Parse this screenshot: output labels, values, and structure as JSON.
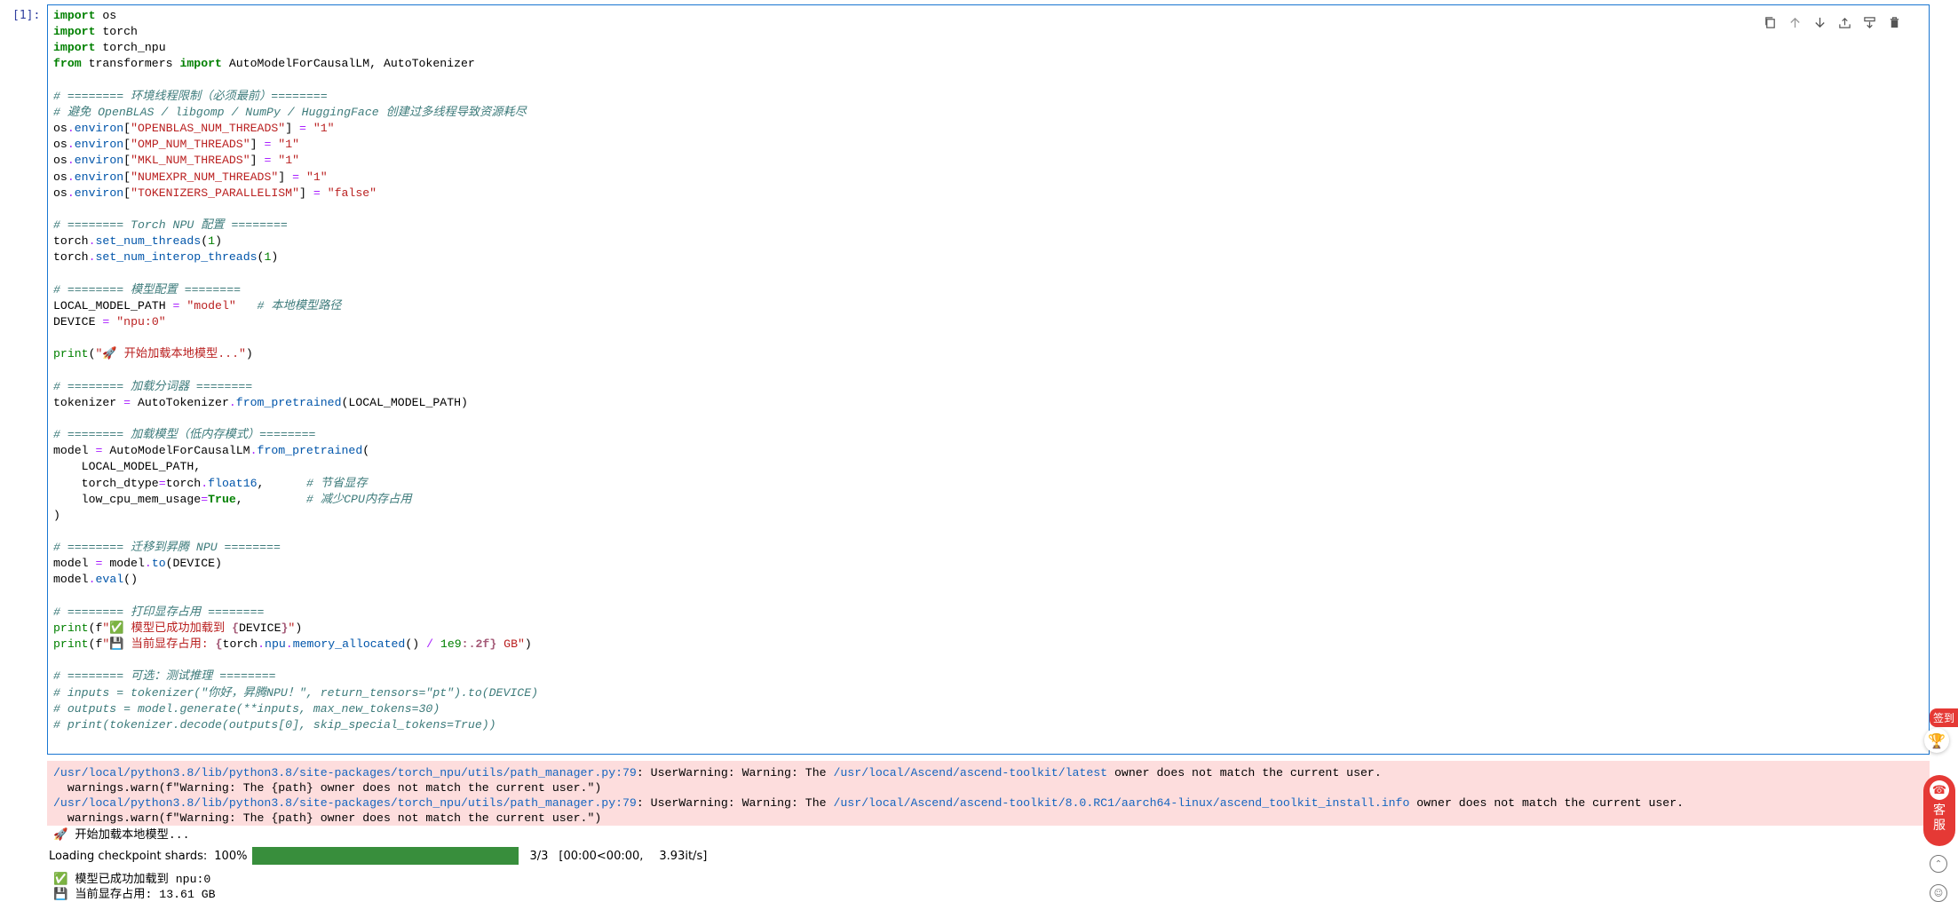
{
  "cell": {
    "prompt": "[1]:",
    "code_lines": [
      [
        {
          "t": "import",
          "c": "kw"
        },
        {
          "t": " os"
        }
      ],
      [
        {
          "t": "import",
          "c": "kw"
        },
        {
          "t": " torch"
        }
      ],
      [
        {
          "t": "import",
          "c": "kw"
        },
        {
          "t": " torch_npu"
        }
      ],
      [
        {
          "t": "from",
          "c": "kw"
        },
        {
          "t": " transformers "
        },
        {
          "t": "import",
          "c": "kw"
        },
        {
          "t": " AutoModelForCausalLM, AutoTokenizer"
        }
      ],
      [],
      [
        {
          "t": "# ======== 环境线程限制（必须最前）========",
          "c": "cm"
        }
      ],
      [
        {
          "t": "# 避免 OpenBLAS / libgomp / NumPy / HuggingFace 创建过多线程导致资源耗尽",
          "c": "cm"
        }
      ],
      [
        {
          "t": "os"
        },
        {
          "t": ".",
          "c": "op"
        },
        {
          "t": "environ",
          "c": "fn"
        },
        {
          "t": "["
        },
        {
          "t": "\"OPENBLAS_NUM_THREADS\"",
          "c": "str"
        },
        {
          "t": "] "
        },
        {
          "t": "=",
          "c": "op"
        },
        {
          "t": " "
        },
        {
          "t": "\"1\"",
          "c": "str"
        }
      ],
      [
        {
          "t": "os"
        },
        {
          "t": ".",
          "c": "op"
        },
        {
          "t": "environ",
          "c": "fn"
        },
        {
          "t": "["
        },
        {
          "t": "\"OMP_NUM_THREADS\"",
          "c": "str"
        },
        {
          "t": "] "
        },
        {
          "t": "=",
          "c": "op"
        },
        {
          "t": " "
        },
        {
          "t": "\"1\"",
          "c": "str"
        }
      ],
      [
        {
          "t": "os"
        },
        {
          "t": ".",
          "c": "op"
        },
        {
          "t": "environ",
          "c": "fn"
        },
        {
          "t": "["
        },
        {
          "t": "\"MKL_NUM_THREADS\"",
          "c": "str"
        },
        {
          "t": "] "
        },
        {
          "t": "=",
          "c": "op"
        },
        {
          "t": " "
        },
        {
          "t": "\"1\"",
          "c": "str"
        }
      ],
      [
        {
          "t": "os"
        },
        {
          "t": ".",
          "c": "op"
        },
        {
          "t": "environ",
          "c": "fn"
        },
        {
          "t": "["
        },
        {
          "t": "\"NUMEXPR_NUM_THREADS\"",
          "c": "str"
        },
        {
          "t": "] "
        },
        {
          "t": "=",
          "c": "op"
        },
        {
          "t": " "
        },
        {
          "t": "\"1\"",
          "c": "str"
        }
      ],
      [
        {
          "t": "os"
        },
        {
          "t": ".",
          "c": "op"
        },
        {
          "t": "environ",
          "c": "fn"
        },
        {
          "t": "["
        },
        {
          "t": "\"TOKENIZERS_PARALLELISM\"",
          "c": "str"
        },
        {
          "t": "] "
        },
        {
          "t": "=",
          "c": "op"
        },
        {
          "t": " "
        },
        {
          "t": "\"false\"",
          "c": "str"
        }
      ],
      [],
      [
        {
          "t": "# ======== Torch NPU 配置 ========",
          "c": "cm"
        }
      ],
      [
        {
          "t": "torch"
        },
        {
          "t": ".",
          "c": "op"
        },
        {
          "t": "set_num_threads",
          "c": "fn"
        },
        {
          "t": "("
        },
        {
          "t": "1",
          "c": "num"
        },
        {
          "t": ")"
        }
      ],
      [
        {
          "t": "torch"
        },
        {
          "t": ".",
          "c": "op"
        },
        {
          "t": "set_num_interop_threads",
          "c": "fn"
        },
        {
          "t": "("
        },
        {
          "t": "1",
          "c": "num"
        },
        {
          "t": ")"
        }
      ],
      [],
      [
        {
          "t": "# ======== 模型配置 ========",
          "c": "cm"
        }
      ],
      [
        {
          "t": "LOCAL_MODEL_PATH "
        },
        {
          "t": "=",
          "c": "op"
        },
        {
          "t": " "
        },
        {
          "t": "\"model\"",
          "c": "str"
        },
        {
          "t": "   "
        },
        {
          "t": "# 本地模型路径",
          "c": "cm"
        }
      ],
      [
        {
          "t": "DEVICE "
        },
        {
          "t": "=",
          "c": "op"
        },
        {
          "t": " "
        },
        {
          "t": "\"npu:0\"",
          "c": "str"
        }
      ],
      [],
      [
        {
          "t": "print",
          "c": "kw2"
        },
        {
          "t": "("
        },
        {
          "t": "\"🚀 开始加载本地模型...\"",
          "c": "str"
        },
        {
          "t": ")"
        }
      ],
      [],
      [
        {
          "t": "# ======== 加载分词器 ========",
          "c": "cm"
        }
      ],
      [
        {
          "t": "tokenizer "
        },
        {
          "t": "=",
          "c": "op"
        },
        {
          "t": " AutoTokenizer"
        },
        {
          "t": ".",
          "c": "op"
        },
        {
          "t": "from_pretrained",
          "c": "fn"
        },
        {
          "t": "(LOCAL_MODEL_PATH)"
        }
      ],
      [],
      [
        {
          "t": "# ======== 加载模型（低内存模式）========",
          "c": "cm"
        }
      ],
      [
        {
          "t": "model "
        },
        {
          "t": "=",
          "c": "op"
        },
        {
          "t": " AutoModelForCausalLM"
        },
        {
          "t": ".",
          "c": "op"
        },
        {
          "t": "from_pretrained",
          "c": "fn"
        },
        {
          "t": "("
        }
      ],
      [
        {
          "t": "    LOCAL_MODEL_PATH,"
        }
      ],
      [
        {
          "t": "    torch_dtype"
        },
        {
          "t": "=",
          "c": "op"
        },
        {
          "t": "torch"
        },
        {
          "t": ".",
          "c": "op"
        },
        {
          "t": "float16",
          "c": "fn"
        },
        {
          "t": ",      "
        },
        {
          "t": "# 节省显存",
          "c": "cm"
        }
      ],
      [
        {
          "t": "    low_cpu_mem_usage"
        },
        {
          "t": "=",
          "c": "op"
        },
        {
          "t": "True",
          "c": "kw"
        },
        {
          "t": ",         "
        },
        {
          "t": "# 减少CPU内存占用",
          "c": "cm"
        }
      ],
      [
        {
          "t": ")"
        }
      ],
      [],
      [
        {
          "t": "# ======== 迁移到昇腾 NPU ========",
          "c": "cm"
        }
      ],
      [
        {
          "t": "model "
        },
        {
          "t": "=",
          "c": "op"
        },
        {
          "t": " model"
        },
        {
          "t": ".",
          "c": "op"
        },
        {
          "t": "to",
          "c": "fn"
        },
        {
          "t": "(DEVICE)"
        }
      ],
      [
        {
          "t": "model"
        },
        {
          "t": ".",
          "c": "op"
        },
        {
          "t": "eval",
          "c": "fn"
        },
        {
          "t": "()"
        }
      ],
      [],
      [
        {
          "t": "# ======== 打印显存占用 ========",
          "c": "cm"
        }
      ],
      [
        {
          "t": "print",
          "c": "kw2"
        },
        {
          "t": "(f"
        },
        {
          "t": "\"✅ 模型已成功加载到 ",
          "c": "str"
        },
        {
          "t": "{",
          "c": "sty"
        },
        {
          "t": "DEVICE"
        },
        {
          "t": "}",
          "c": "sty"
        },
        {
          "t": "\"",
          "c": "str"
        },
        {
          "t": ")"
        }
      ],
      [
        {
          "t": "print",
          "c": "kw2"
        },
        {
          "t": "(f"
        },
        {
          "t": "\"💾 当前显存占用: ",
          "c": "str"
        },
        {
          "t": "{",
          "c": "sty"
        },
        {
          "t": "torch"
        },
        {
          "t": ".",
          "c": "op"
        },
        {
          "t": "npu",
          "c": "fn"
        },
        {
          "t": ".",
          "c": "op"
        },
        {
          "t": "memory_allocated",
          "c": "fn"
        },
        {
          "t": "() "
        },
        {
          "t": "/",
          "c": "op"
        },
        {
          "t": " "
        },
        {
          "t": "1e9",
          "c": "num"
        },
        {
          "t": ":.2f",
          "c": "sty"
        },
        {
          "t": "}",
          "c": "sty"
        },
        {
          "t": " GB\"",
          "c": "str"
        },
        {
          "t": ")"
        }
      ],
      [],
      [
        {
          "t": "# ======== 可选：测试推理 ========",
          "c": "cm"
        }
      ],
      [
        {
          "t": "# inputs = tokenizer(\"你好，昇腾NPU！\", return_tensors=\"pt\").to(DEVICE)",
          "c": "cm"
        }
      ],
      [
        {
          "t": "# outputs = model.generate(**inputs, max_new_tokens=30)",
          "c": "cm"
        }
      ],
      [
        {
          "t": "# print(tokenizer.decode(outputs[0], skip_special_tokens=True))",
          "c": "cm"
        }
      ]
    ]
  },
  "toolbar": {
    "icons": [
      "copy-icon",
      "move-up-icon",
      "move-down-icon",
      "insert-above-icon",
      "insert-below-icon",
      "delete-icon"
    ]
  },
  "stderr": {
    "lines": [
      [
        {
          "t": "/usr/local/python3.8/lib/python3.8/site-packages/torch_npu/utils/path_manager.py:79",
          "c": "path"
        },
        {
          "t": ": UserWarning: Warning: The "
        },
        {
          "t": "/usr/local/Ascend/ascend-toolkit/latest",
          "c": "path"
        },
        {
          "t": " owner does not match the current user."
        }
      ],
      [
        {
          "t": "  warnings.warn(f\"Warning: The {path} owner does not match the current user.\")"
        }
      ],
      [
        {
          "t": "/usr/local/python3.8/lib/python3.8/site-packages/torch_npu/utils/path_manager.py:79",
          "c": "path"
        },
        {
          "t": ": UserWarning: Warning: The "
        },
        {
          "t": "/usr/local/Ascend/ascend-toolkit/8.0.RC1/aarch64-linux/ascend_toolkit_install.info",
          "c": "path"
        },
        {
          "t": " owner does not match the current user."
        }
      ],
      [
        {
          "t": "  warnings.warn(f\"Warning: The {path} owner does not match the current user.\")"
        }
      ]
    ]
  },
  "stdout": {
    "start_msg": "🚀 开始加载本地模型...",
    "loaded_msg": "✅ 模型已成功加载到 npu:0",
    "memory_msg": "💾 当前显存占用: 13.61 GB"
  },
  "progress": {
    "label": "Loading checkpoint shards:",
    "percent_text": "100%",
    "fraction": 1.0,
    "count": "3/3",
    "timing": "[00:00<00:00,",
    "rate": "3.93it/s]",
    "fill_color": "#388e3c"
  },
  "side_widgets": {
    "signin_label": "签到",
    "service_label_1": "客",
    "service_label_2": "服"
  }
}
